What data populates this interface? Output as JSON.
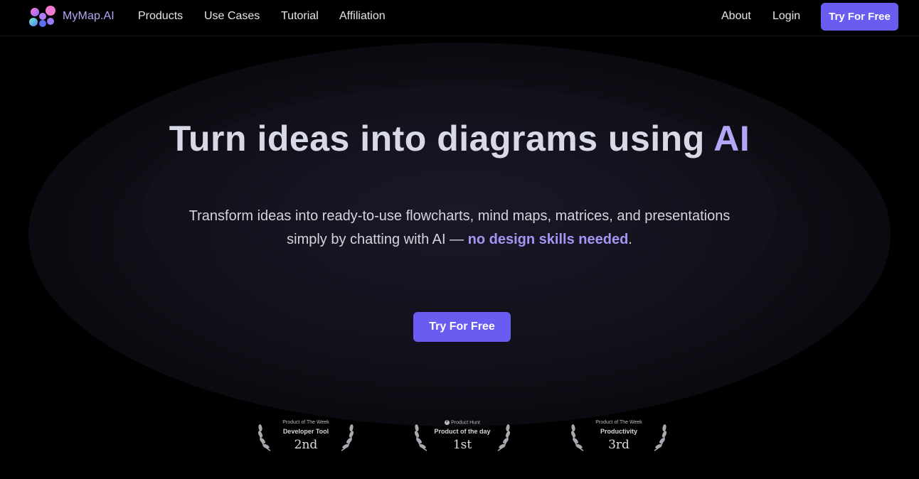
{
  "nav": {
    "brand": "MyMap.AI",
    "links": [
      "Products",
      "Use Cases",
      "Tutorial",
      "Affiliation"
    ],
    "about": "About",
    "login": "Login",
    "cta": "Try For Free"
  },
  "hero": {
    "title_main": "Turn ideas into diagrams using ",
    "title_accent": "AI",
    "subtitle_line1": "Transform ideas into ready-to-use flowcharts, mind maps, matrices, and presentations",
    "subtitle_line2_pre": "simply by chatting with AI — ",
    "subtitle_highlight": "no design skills needed",
    "subtitle_end": ".",
    "cta": "Try For Free"
  },
  "badges": [
    {
      "top": "Product of The Week",
      "category": "Developer Tool",
      "rank": "2nd"
    },
    {
      "top": "Product Hunt",
      "category": "Product of the day",
      "rank": "1st"
    },
    {
      "top": "Product of The Week",
      "category": "Productivity",
      "rank": "3rd"
    }
  ],
  "colors": {
    "accent": "#6a5cf0",
    "accent_text": "#b3a6f6",
    "background": "#000000"
  }
}
